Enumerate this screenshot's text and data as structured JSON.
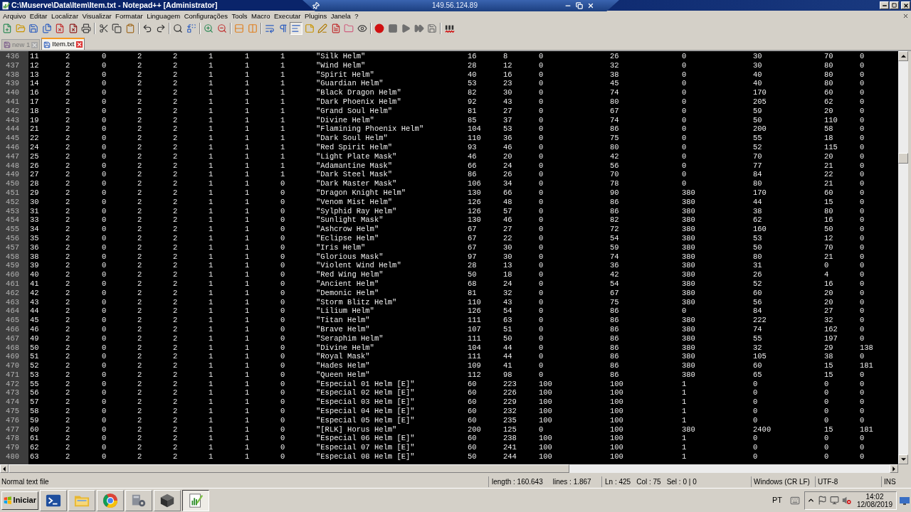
{
  "title_bar": {
    "title": "C:\\Muserve\\Data\\Item\\Item.txt - Notepad++ [Administrator]"
  },
  "connection_bar": {
    "host": "149.56.124.89"
  },
  "menu": [
    "Arquivo",
    "Editar",
    "Localizar",
    "Visualizar",
    "Formatar",
    "Linguagem",
    "Configurações",
    "Tools",
    "Macro",
    "Executar",
    "Plugins",
    "Janela",
    "?"
  ],
  "toolbar": [
    {
      "buttons": [
        {
          "kind": "new",
          "pressed": false
        },
        {
          "kind": "open",
          "pressed": false
        },
        {
          "kind": "save",
          "pressed": false
        },
        {
          "kind": "save_all",
          "pressed": false
        },
        {
          "kind": "close",
          "pressed": false
        },
        {
          "kind": "close_all",
          "pressed": false
        },
        {
          "kind": "print",
          "pressed": false
        }
      ]
    },
    {
      "buttons": [
        {
          "kind": "cut",
          "pressed": false
        },
        {
          "kind": "copy",
          "pressed": false
        },
        {
          "kind": "paste",
          "pressed": false
        }
      ]
    },
    {
      "buttons": [
        {
          "kind": "undo",
          "pressed": false
        },
        {
          "kind": "redo",
          "pressed": false
        }
      ]
    },
    {
      "buttons": [
        {
          "kind": "find",
          "pressed": false
        },
        {
          "kind": "replace",
          "pressed": false
        }
      ]
    },
    {
      "buttons": [
        {
          "kind": "zoom_in",
          "pressed": false
        },
        {
          "kind": "zoom_out",
          "pressed": false
        }
      ]
    },
    {
      "buttons": [
        {
          "kind": "sync_v",
          "pressed": false
        },
        {
          "kind": "sync_h",
          "pressed": false
        }
      ]
    },
    {
      "buttons": [
        {
          "kind": "wrap",
          "pressed": false
        },
        {
          "kind": "all_chars",
          "pressed": false
        },
        {
          "kind": "indent_guide",
          "pressed": true
        },
        {
          "kind": "udl",
          "pressed": false
        },
        {
          "kind": "doc_map",
          "pressed": false
        },
        {
          "kind": "func_list",
          "pressed": false
        },
        {
          "kind": "workspace",
          "pressed": false
        },
        {
          "kind": "monitor",
          "pressed": false
        }
      ]
    },
    {
      "buttons": [
        {
          "kind": "record",
          "pressed": false
        },
        {
          "kind": "stop",
          "pressed": false
        },
        {
          "kind": "play",
          "pressed": false
        },
        {
          "kind": "play_multi",
          "pressed": false
        },
        {
          "kind": "save_macro",
          "pressed": false
        }
      ]
    },
    {
      "buttons": [
        {
          "kind": "spell",
          "pressed": false
        }
      ]
    }
  ],
  "tabs": [
    {
      "label": "new 1",
      "selected": false
    },
    {
      "label": "Item.txt",
      "selected": true
    }
  ],
  "editor": {
    "lines": [
      {
        "number": "436",
        "fields": [
          "11",
          "2",
          "0",
          "2",
          "2",
          "1",
          "1",
          "1",
          "\"Silk Helm\"",
          "16",
          "8",
          "0",
          "26",
          "0",
          "30",
          "70",
          "0"
        ]
      },
      {
        "number": "437",
        "fields": [
          "12",
          "2",
          "0",
          "2",
          "2",
          "1",
          "1",
          "1",
          "\"Wind Helm\"",
          "28",
          "12",
          "0",
          "32",
          "0",
          "30",
          "80",
          "0"
        ]
      },
      {
        "number": "438",
        "fields": [
          "13",
          "2",
          "0",
          "2",
          "2",
          "1",
          "1",
          "1",
          "\"Spirit Helm\"",
          "40",
          "16",
          "0",
          "38",
          "0",
          "40",
          "80",
          "0"
        ]
      },
      {
        "number": "439",
        "fields": [
          "14",
          "2",
          "0",
          "2",
          "2",
          "1",
          "1",
          "1",
          "\"Guardian Helm\"",
          "53",
          "23",
          "0",
          "45",
          "0",
          "40",
          "80",
          "0"
        ]
      },
      {
        "number": "440",
        "fields": [
          "16",
          "2",
          "0",
          "2",
          "2",
          "1",
          "1",
          "1",
          "\"Black Dragon Helm\"",
          "82",
          "30",
          "0",
          "74",
          "0",
          "170",
          "60",
          "0"
        ]
      },
      {
        "number": "441",
        "fields": [
          "17",
          "2",
          "0",
          "2",
          "2",
          "1",
          "1",
          "1",
          "\"Dark Phoenix Helm\"",
          "92",
          "43",
          "0",
          "80",
          "0",
          "205",
          "62",
          "0"
        ]
      },
      {
        "number": "442",
        "fields": [
          "18",
          "2",
          "0",
          "2",
          "2",
          "1",
          "1",
          "1",
          "\"Grand Soul Helm\"",
          "81",
          "27",
          "0",
          "67",
          "0",
          "59",
          "20",
          "0"
        ]
      },
      {
        "number": "443",
        "fields": [
          "19",
          "2",
          "0",
          "2",
          "2",
          "1",
          "1",
          "1",
          "\"Divine Helm\"",
          "85",
          "37",
          "0",
          "74",
          "0",
          "50",
          "110",
          "0"
        ]
      },
      {
        "number": "444",
        "fields": [
          "21",
          "2",
          "0",
          "2",
          "2",
          "1",
          "1",
          "1",
          "\"Flamining Phoenix Helm\"",
          "104",
          "53",
          "0",
          "86",
          "0",
          "200",
          "58",
          "0"
        ]
      },
      {
        "number": "445",
        "fields": [
          "22",
          "2",
          "0",
          "2",
          "2",
          "1",
          "1",
          "1",
          "\"Dark Soul Helm\"",
          "110",
          "36",
          "0",
          "75",
          "0",
          "55",
          "18",
          "0"
        ]
      },
      {
        "number": "446",
        "fields": [
          "24",
          "2",
          "0",
          "2",
          "2",
          "1",
          "1",
          "1",
          "\"Red Spirit Helm\"",
          "93",
          "46",
          "0",
          "80",
          "0",
          "52",
          "115",
          "0"
        ]
      },
      {
        "number": "447",
        "fields": [
          "25",
          "2",
          "0",
          "2",
          "2",
          "1",
          "1",
          "1",
          "\"Light Plate Mask\"",
          "46",
          "20",
          "0",
          "42",
          "0",
          "70",
          "20",
          "0"
        ]
      },
      {
        "number": "448",
        "fields": [
          "26",
          "2",
          "0",
          "2",
          "2",
          "1",
          "1",
          "1",
          "\"Adamantine Mask\"",
          "66",
          "24",
          "0",
          "56",
          "0",
          "77",
          "21",
          "0"
        ]
      },
      {
        "number": "449",
        "fields": [
          "27",
          "2",
          "0",
          "2",
          "2",
          "1",
          "1",
          "1",
          "\"Dark Steel Mask\"",
          "86",
          "26",
          "0",
          "70",
          "0",
          "84",
          "22",
          "0"
        ]
      },
      {
        "number": "450",
        "fields": [
          "28",
          "2",
          "0",
          "2",
          "2",
          "1",
          "1",
          "0",
          "\"Dark Master Mask\"",
          "106",
          "34",
          "0",
          "78",
          "0",
          "80",
          "21",
          "0"
        ]
      },
      {
        "number": "451",
        "fields": [
          "29",
          "2",
          "0",
          "2",
          "2",
          "1",
          "1",
          "0",
          "\"Dragon Knight Helm\"",
          "130",
          "66",
          "0",
          "90",
          "380",
          "170",
          "60",
          "0"
        ]
      },
      {
        "number": "452",
        "fields": [
          "30",
          "2",
          "0",
          "2",
          "2",
          "1",
          "1",
          "0",
          "\"Venom Mist Helm\"",
          "126",
          "48",
          "0",
          "86",
          "380",
          "44",
          "15",
          "0"
        ]
      },
      {
        "number": "453",
        "fields": [
          "31",
          "2",
          "0",
          "2",
          "2",
          "1",
          "1",
          "0",
          "\"Sylphid Ray Helm\"",
          "126",
          "57",
          "0",
          "86",
          "380",
          "38",
          "80",
          "0"
        ]
      },
      {
        "number": "454",
        "fields": [
          "33",
          "2",
          "0",
          "2",
          "2",
          "1",
          "1",
          "0",
          "\"Sunlight Mask\"",
          "130",
          "46",
          "0",
          "82",
          "380",
          "62",
          "16",
          "0"
        ]
      },
      {
        "number": "455",
        "fields": [
          "34",
          "2",
          "0",
          "2",
          "2",
          "1",
          "1",
          "0",
          "\"Ashcrow Helm\"",
          "67",
          "27",
          "0",
          "72",
          "380",
          "160",
          "50",
          "0"
        ]
      },
      {
        "number": "456",
        "fields": [
          "35",
          "2",
          "0",
          "2",
          "2",
          "1",
          "1",
          "0",
          "\"Eclipse Helm\"",
          "67",
          "22",
          "0",
          "54",
          "380",
          "53",
          "12",
          "0"
        ]
      },
      {
        "number": "457",
        "fields": [
          "36",
          "2",
          "0",
          "2",
          "2",
          "1",
          "1",
          "0",
          "\"Iris Helm\"",
          "67",
          "30",
          "0",
          "59",
          "380",
          "50",
          "70",
          "0"
        ]
      },
      {
        "number": "458",
        "fields": [
          "38",
          "2",
          "0",
          "2",
          "2",
          "1",
          "1",
          "0",
          "\"Glorious Mask\"",
          "97",
          "30",
          "0",
          "74",
          "380",
          "80",
          "21",
          "0"
        ]
      },
      {
        "number": "459",
        "fields": [
          "39",
          "2",
          "0",
          "2",
          "2",
          "1",
          "1",
          "0",
          "\"Violent Wind Helm\"",
          "28",
          "13",
          "0",
          "36",
          "380",
          "31",
          "0",
          "0"
        ]
      },
      {
        "number": "460",
        "fields": [
          "40",
          "2",
          "0",
          "2",
          "2",
          "1",
          "1",
          "0",
          "\"Red Wing Helm\"",
          "50",
          "18",
          "0",
          "42",
          "380",
          "26",
          "4",
          "0"
        ]
      },
      {
        "number": "461",
        "fields": [
          "41",
          "2",
          "0",
          "2",
          "2",
          "1",
          "1",
          "0",
          "\"Ancient Helm\"",
          "68",
          "24",
          "0",
          "54",
          "380",
          "52",
          "16",
          "0"
        ]
      },
      {
        "number": "462",
        "fields": [
          "42",
          "2",
          "0",
          "2",
          "2",
          "1",
          "1",
          "0",
          "\"Demonic Helm\"",
          "81",
          "32",
          "0",
          "67",
          "380",
          "60",
          "20",
          "0"
        ]
      },
      {
        "number": "463",
        "fields": [
          "43",
          "2",
          "0",
          "2",
          "2",
          "1",
          "1",
          "0",
          "\"Storm Blitz Helm\"",
          "110",
          "43",
          "0",
          "75",
          "380",
          "56",
          "20",
          "0"
        ]
      },
      {
        "number": "464",
        "fields": [
          "44",
          "2",
          "0",
          "2",
          "2",
          "1",
          "1",
          "0",
          "\"Lilium Helm\"",
          "126",
          "54",
          "0",
          "86",
          "0",
          "84",
          "27",
          "0"
        ]
      },
      {
        "number": "465",
        "fields": [
          "45",
          "2",
          "0",
          "2",
          "2",
          "1",
          "1",
          "0",
          "\"Titan Helm\"",
          "111",
          "63",
          "0",
          "86",
          "380",
          "222",
          "32",
          "0"
        ]
      },
      {
        "number": "466",
        "fields": [
          "46",
          "2",
          "0",
          "2",
          "2",
          "1",
          "1",
          "0",
          "\"Brave Helm\"",
          "107",
          "51",
          "0",
          "86",
          "380",
          "74",
          "162",
          "0"
        ]
      },
      {
        "number": "467",
        "fields": [
          "49",
          "2",
          "0",
          "2",
          "2",
          "1",
          "1",
          "0",
          "\"Seraphim Helm\"",
          "111",
          "50",
          "0",
          "86",
          "380",
          "55",
          "197",
          "0"
        ]
      },
      {
        "number": "468",
        "fields": [
          "50",
          "2",
          "0",
          "2",
          "2",
          "1",
          "1",
          "0",
          "\"Divine Helm\"",
          "104",
          "44",
          "0",
          "86",
          "380",
          "32",
          "29",
          "138"
        ]
      },
      {
        "number": "469",
        "fields": [
          "51",
          "2",
          "0",
          "2",
          "2",
          "1",
          "1",
          "0",
          "\"Royal Mask\"",
          "111",
          "44",
          "0",
          "86",
          "380",
          "105",
          "38",
          "0"
        ]
      },
      {
        "number": "470",
        "fields": [
          "52",
          "2",
          "0",
          "2",
          "2",
          "1",
          "1",
          "0",
          "\"Hades Helm\"",
          "109",
          "41",
          "0",
          "86",
          "380",
          "60",
          "15",
          "181"
        ]
      },
      {
        "number": "471",
        "fields": [
          "53",
          "2",
          "0",
          "2",
          "2",
          "1",
          "1",
          "0",
          "\"Queen Helm\"",
          "112",
          "98",
          "0",
          "86",
          "380",
          "65",
          "15",
          "0"
        ]
      },
      {
        "number": "472",
        "fields": [
          "55",
          "2",
          "0",
          "2",
          "2",
          "1",
          "1",
          "0",
          "\"Especial 01 Helm [E]\"",
          "60",
          "223",
          "100",
          "100",
          "1",
          "0",
          "0",
          "0"
        ]
      },
      {
        "number": "473",
        "fields": [
          "56",
          "2",
          "0",
          "2",
          "2",
          "1",
          "1",
          "0",
          "\"Especial 02 Helm [E]\"",
          "60",
          "226",
          "100",
          "100",
          "1",
          "0",
          "0",
          "0"
        ]
      },
      {
        "number": "474",
        "fields": [
          "57",
          "2",
          "0",
          "2",
          "2",
          "1",
          "1",
          "0",
          "\"Especial 03 Helm [E]\"",
          "60",
          "229",
          "100",
          "100",
          "1",
          "0",
          "0",
          "0"
        ]
      },
      {
        "number": "475",
        "fields": [
          "58",
          "2",
          "0",
          "2",
          "2",
          "1",
          "1",
          "0",
          "\"Especial 04 Helm [E]\"",
          "60",
          "232",
          "100",
          "100",
          "1",
          "0",
          "0",
          "0"
        ]
      },
      {
        "number": "476",
        "fields": [
          "59",
          "2",
          "0",
          "2",
          "2",
          "1",
          "1",
          "0",
          "\"Especial 05 Helm [E]\"",
          "60",
          "235",
          "100",
          "100",
          "1",
          "0",
          "0",
          "0"
        ]
      },
      {
        "number": "477",
        "fields": [
          "60",
          "2",
          "0",
          "2",
          "2",
          "1",
          "1",
          "0",
          "\"[RLK] Horus Helm\"",
          "200",
          "125",
          "0",
          "100",
          "380",
          "2400",
          "15",
          "181"
        ]
      },
      {
        "number": "478",
        "fields": [
          "61",
          "2",
          "0",
          "2",
          "2",
          "1",
          "1",
          "0",
          "\"Especial 06 Helm [E]\"",
          "60",
          "238",
          "100",
          "100",
          "1",
          "0",
          "0",
          "0"
        ]
      },
      {
        "number": "479",
        "fields": [
          "62",
          "2",
          "0",
          "2",
          "2",
          "1",
          "1",
          "0",
          "\"Especial 07 Helm [E]\"",
          "60",
          "241",
          "100",
          "100",
          "1",
          "0",
          "0",
          "0"
        ]
      },
      {
        "number": "480",
        "fields": [
          "63",
          "2",
          "0",
          "2",
          "2",
          "1",
          "1",
          "0",
          "\"Especial 08 Helm [E]\"",
          "50",
          "244",
          "100",
          "100",
          "1",
          "0",
          "0",
          "0"
        ]
      }
    ]
  },
  "status_bar": {
    "file_type": "Normal text file",
    "length": "length : 160.643",
    "lines": "lines : 1.867",
    "line": "Ln : 425",
    "column": "Col : 75",
    "selection": "Sel : 0 | 0",
    "eol": "Windows (CR LF)",
    "encoding": "UTF-8",
    "mode": "INS"
  },
  "taskbar": {
    "start": "Iniciar",
    "apps": [
      {
        "kind": "terminal",
        "selected": false
      },
      {
        "kind": "explorer",
        "selected": false
      },
      {
        "kind": "round",
        "selected": false
      },
      {
        "kind": "tools",
        "selected": false
      },
      {
        "kind": "cube",
        "selected": false
      },
      {
        "kind": "notepad",
        "selected": true
      }
    ],
    "language": "PT",
    "time": "14:02",
    "date": "12/08/2019"
  }
}
